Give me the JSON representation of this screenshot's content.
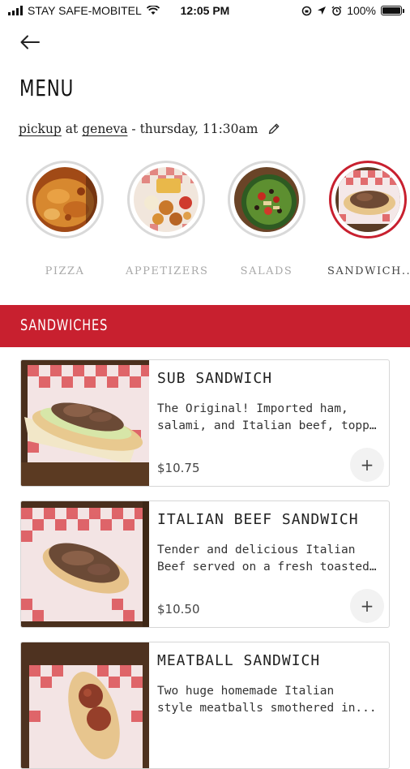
{
  "status_bar": {
    "carrier": "STAY SAFE-MOBITEL",
    "time": "12:05 PM",
    "battery": "100%",
    "battery_level": 1.0
  },
  "header": {
    "title": "MENU",
    "order_mode": "pickup",
    "at_word": "at",
    "location": "geneva",
    "time_text": "- thursday, 11:30am"
  },
  "categories": [
    {
      "label": "PIZZA",
      "icon": "pizza-photo",
      "active": false
    },
    {
      "label": "APPETIZERS",
      "icon": "appetizers-photo",
      "active": false
    },
    {
      "label": "SALADS",
      "icon": "salad-photo",
      "active": false
    },
    {
      "label": "SANDWICH...",
      "icon": "sandwich-photo",
      "active": true
    }
  ],
  "section": {
    "title": "SANDWICHES"
  },
  "items": [
    {
      "name": "SUB SANDWICH",
      "desc_line1": "The Original! Imported ham,",
      "desc_line2": "salami, and Italian beef, toppe...",
      "price": "$10.75",
      "add_symbol": "+"
    },
    {
      "name": "ITALIAN BEEF SANDWICH",
      "desc_line1": "Tender and delicious Italian",
      "desc_line2": "Beef served on a fresh toasted...",
      "price": "$10.50",
      "add_symbol": "+"
    },
    {
      "name": "MEATBALL SANDWICH",
      "desc_line1": "Two huge homemade Italian",
      "desc_line2": "style meatballs smothered in...",
      "price": "",
      "add_symbol": "+"
    }
  ],
  "colors": {
    "accent": "#c8202f",
    "ring_inactive": "#d9d9d9",
    "label_inactive": "#a9a9a9"
  }
}
